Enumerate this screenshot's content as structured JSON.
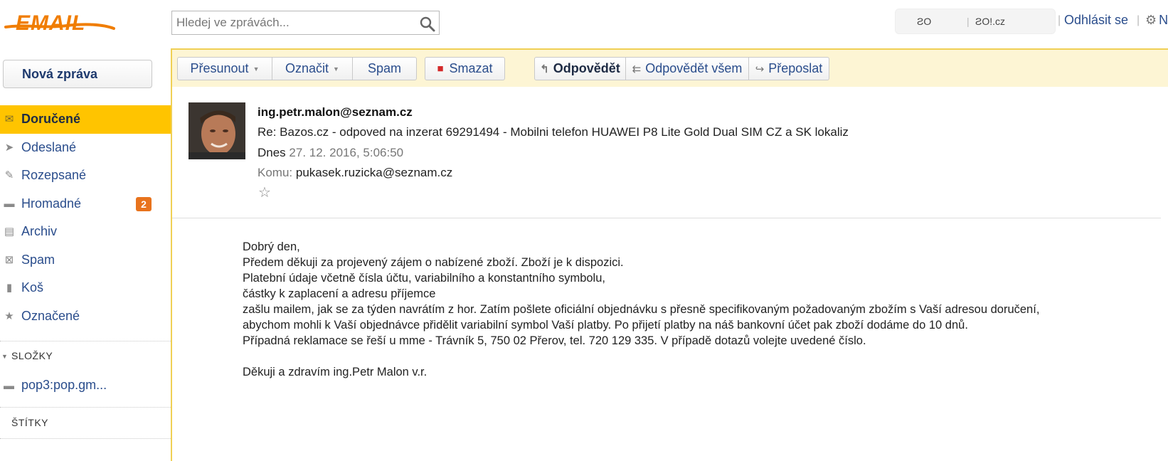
{
  "app": {
    "logo_text": "EMAIL",
    "colors": {
      "brand_orange": "#f07d00",
      "active_folder": "#ffc400",
      "badge": "#e8731d",
      "link": "#2a4d8c",
      "toolbar_bg": "#fdf5d4"
    }
  },
  "header": {
    "search_placeholder": "Hledej ve zprávách...",
    "search_icon": "search-icon",
    "user_fragments": [
      "ƧO",
      "ƧO!.cz"
    ],
    "logout_label": "Odhlásit se",
    "settings_icon": "gear-icon",
    "settings_label": "Na"
  },
  "sidebar": {
    "compose_label": "Nová zpráva",
    "folders": [
      {
        "label": "Doručené",
        "icon": "envelope-icon",
        "active": true
      },
      {
        "label": "Odeslané",
        "icon": "paper-plane-icon"
      },
      {
        "label": "Rozepsané",
        "icon": "edit-icon"
      },
      {
        "label": "Hromadné",
        "icon": "folder-icon",
        "badge": "2"
      },
      {
        "label": "Archiv",
        "icon": "archive-icon"
      },
      {
        "label": "Spam",
        "icon": "spam-folder-icon"
      },
      {
        "label": "Koš",
        "icon": "trash-icon"
      },
      {
        "label": "Označené",
        "icon": "star-icon"
      }
    ],
    "folders_section_title": "SLOŽKY",
    "custom_folder": "pop3:pop.gm...",
    "tags_section_title": "ŠTÍTKY"
  },
  "toolbar": {
    "move_label": "Přesunout",
    "mark_label": "Označit",
    "spam_label": "Spam",
    "delete_label": "Smazat",
    "reply_label": "Odpovědět",
    "reply_all_label": "Odpovědět všem",
    "forward_label": "Přeposlat"
  },
  "message": {
    "sender": "ing.petr.malon@seznam.cz",
    "subject": "Re: Bazos.cz - odpoved na inzerat 69291494 - Mobilni telefon HUAWEI P8 Lite Gold Dual SIM CZ a SK lokaliz",
    "date_prefix": "Dnes",
    "date": "27. 12. 2016, 5:06:50",
    "to_prefix": "Komu:",
    "to": "pukasek.ruzicka@seznam.cz",
    "body_lines": [
      "Dobrý den,",
      "Předem děkuji za projevený zájem o nabízené zboží. Zboží je k dispozici.",
      "Platební údaje včetně čísla účtu, variabilního a konstantního symbolu,",
      "částky k zaplacení a adresu příjemce",
      "zašlu mailem, jak se za týden navrátím z hor. Zatím pošlete oficiální objednávku s přesně specifikovaným požadovaným zbožím s Vaší adresou doručení,",
      "abychom mohli k Vaší objednávce přidělit variabilní symbol Vaší platby. Po přijetí platby na náš bankovní účet pak zboží dodáme do 10 dnů.",
      "Případná reklamace se řeší u mme - Trávník 5, 750 02 Přerov, tel. 720 129 335. V případě dotazů volejte uvedené číslo.",
      "",
      "Děkuji a zdravím ing.Petr Malon v.r."
    ]
  }
}
